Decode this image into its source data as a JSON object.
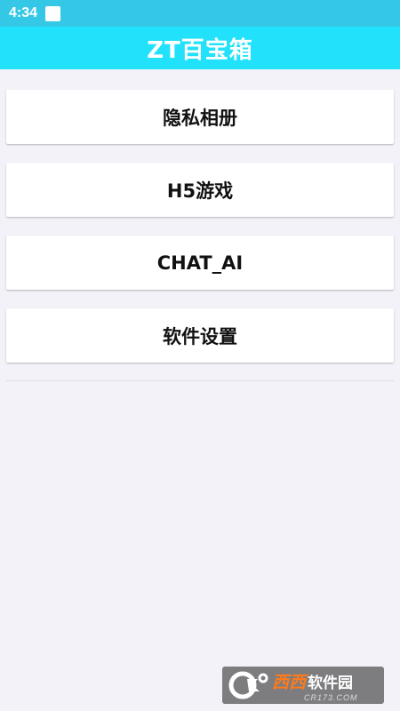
{
  "status_bar": {
    "time": "4:34",
    "background": "#35c8e6"
  },
  "app_bar": {
    "title": "ZT百宝箱",
    "background": "#22e2fb"
  },
  "menu": {
    "items": [
      {
        "label": "隐私相册"
      },
      {
        "label": "H5游戏"
      },
      {
        "label": "CHAT_AI"
      },
      {
        "label": "软件设置"
      }
    ]
  },
  "watermark": {
    "brand": "西西",
    "site": "软件园",
    "url": "CR173.COM"
  }
}
